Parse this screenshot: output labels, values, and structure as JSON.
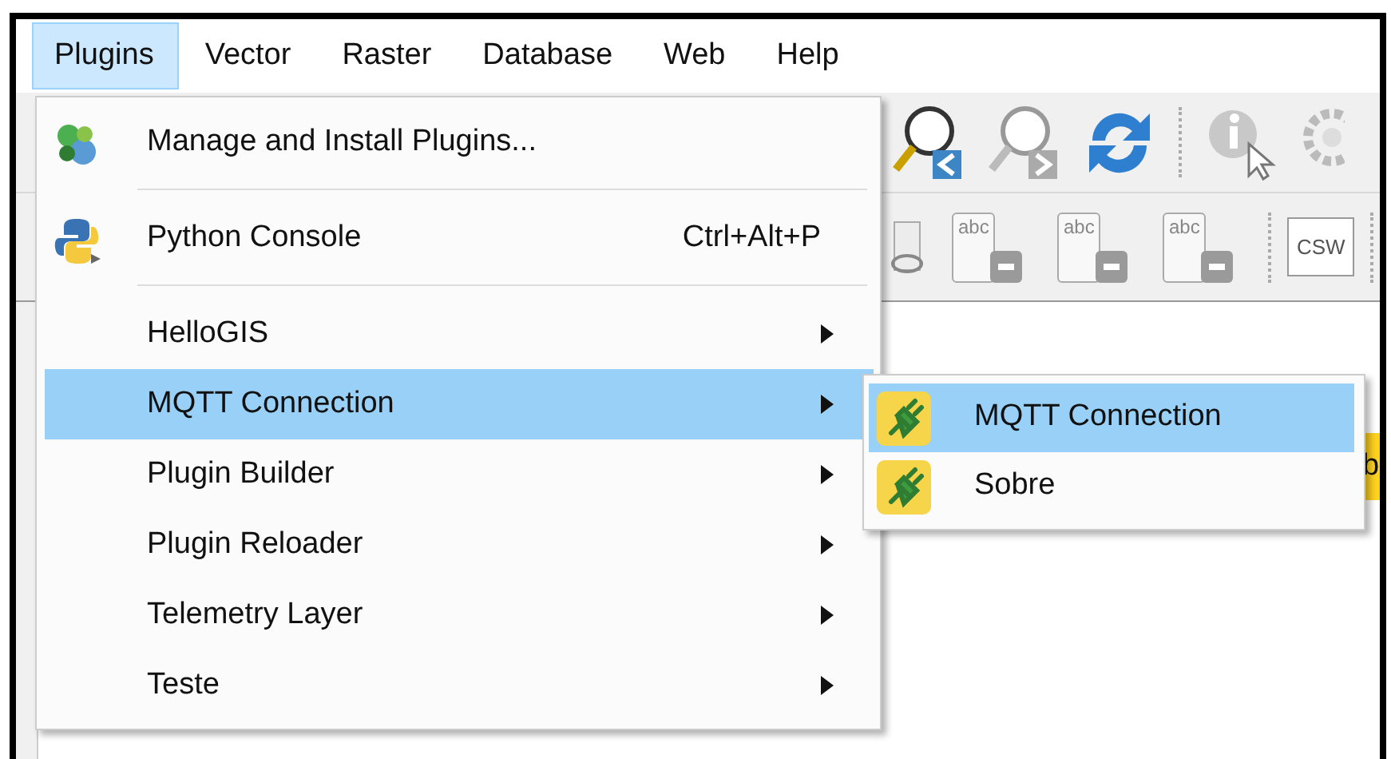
{
  "menubar": [
    {
      "label": "Plugins",
      "selected": true
    },
    {
      "label": "Vector",
      "selected": false
    },
    {
      "label": "Raster",
      "selected": false
    },
    {
      "label": "Database",
      "selected": false
    },
    {
      "label": "Web",
      "selected": false
    },
    {
      "label": "Help",
      "selected": false
    }
  ],
  "toolbar": {
    "label_buttons": [
      "abc",
      "abc",
      "abc"
    ],
    "service_button": "CSW"
  },
  "canvas_tag": "b",
  "plugins_menu": [
    {
      "kind": "manager",
      "label": "Manage and Install Plugins...",
      "selected": false
    },
    {
      "kind": "separator"
    },
    {
      "kind": "console",
      "label": "Python Console",
      "shortcut": "Ctrl+Alt+P",
      "selected": false
    },
    {
      "kind": "separator"
    },
    {
      "kind": "submenu",
      "label": "HelloGIS",
      "selected": false
    },
    {
      "kind": "submenu",
      "label": "MQTT Connection",
      "selected": true
    },
    {
      "kind": "submenu",
      "label": "Plugin Builder",
      "selected": false
    },
    {
      "kind": "submenu",
      "label": "Plugin Reloader",
      "selected": false
    },
    {
      "kind": "submenu",
      "label": "Telemetry Layer",
      "selected": false
    },
    {
      "kind": "submenu",
      "label": "Teste",
      "selected": false
    }
  ],
  "submenu": [
    {
      "label": "MQTT Connection",
      "selected": true
    },
    {
      "label": "Sobre",
      "selected": false
    }
  ]
}
